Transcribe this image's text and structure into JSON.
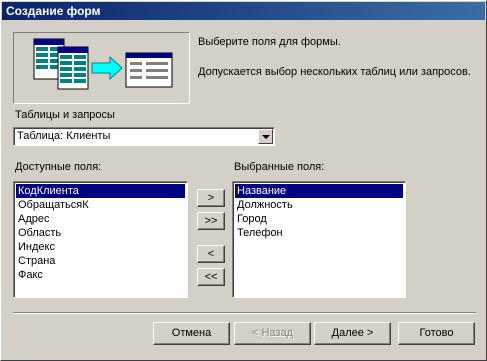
{
  "window": {
    "title": "Создание форм"
  },
  "intro": {
    "line1": "Выберите поля для формы.",
    "line2": "Допускается выбор нескольких таблиц или запросов."
  },
  "source": {
    "label": "Таблицы и запросы",
    "value": "Таблица: Клиенты"
  },
  "available": {
    "label": "Доступные поля:",
    "items": [
      "КодКлиента",
      "ОбращатьсяК",
      "Адрес",
      "Область",
      "Индекс",
      "Страна",
      "Факс"
    ],
    "selected_index": 0
  },
  "selected": {
    "label": "Выбранные поля:",
    "items": [
      "Название",
      "Должность",
      "Город",
      "Телефон"
    ],
    "selected_index": 0
  },
  "transfer": {
    "add_one": ">",
    "add_all": ">>",
    "remove_one": "<",
    "remove_all": "<<"
  },
  "footer": {
    "cancel": "Отмена",
    "back": "< Назад",
    "next": "Далее >",
    "finish": "Готово"
  },
  "colors": {
    "title_start": "#0a246a",
    "title_end": "#3a6ea5",
    "selection": "#000080",
    "face": "#d4d0c8"
  }
}
